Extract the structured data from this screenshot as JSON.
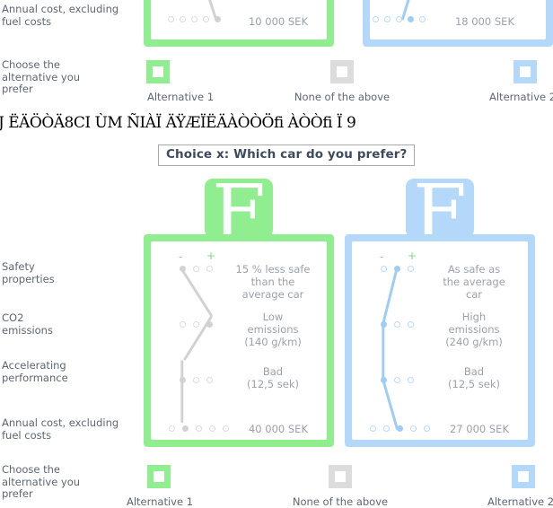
{
  "title": "Choice x: Which car do you prefer?",
  "garbled_line": "J ËÄÖÒÄ8CI ÙM  ÑIÀÏ ÄŸÆÏËÄÀÒÒÖfi   ÀÒÒfi Ï 9",
  "attribute_labels": {
    "safety": "Safety\nproperties",
    "co2": "CO2\nemissions",
    "accel": "Accelerating\nperformance",
    "cost": "Annual cost, excluding\nfuel costs",
    "choose": "Choose the\nalternative you\nprefer"
  },
  "colors": {
    "green": "#90ee90",
    "blue": "#b4d8fa",
    "gray": "#dcdcdc",
    "text": "#5d6773",
    "value_text": "#9aa2ac",
    "title_text": "#3e4a5e"
  },
  "scale_markers": {
    "minus": "-",
    "plus": "+"
  },
  "card_glyph": "F",
  "top_block": {
    "alt1": {
      "cost_value": "10 000 SEK",
      "cost_dots": 5,
      "cost_selected": 5,
      "color": "green"
    },
    "alt2": {
      "cost_value": "18 000 SEK",
      "cost_dots": 5,
      "cost_selected": 4,
      "color": "blue"
    },
    "choices": [
      {
        "label": "Alternative 1",
        "color": "green"
      },
      {
        "label": "None of the above",
        "color": "gray"
      },
      {
        "label": "Alternative 2",
        "color": "blue"
      }
    ]
  },
  "main_block": {
    "alt1": {
      "color": "green",
      "rows": [
        {
          "attr": "safety",
          "dots": 3,
          "selected": 1,
          "text": "15 % less safe\nthan the\naverage car"
        },
        {
          "attr": "co2",
          "dots": 3,
          "selected": 3,
          "text": "Low\nemissions\n(140 g/km)"
        },
        {
          "attr": "accel",
          "dots": 3,
          "selected": 1,
          "text": "Bad\n(12,5 sek)"
        },
        {
          "attr": "cost",
          "dots": 5,
          "selected": 2,
          "text": "40 000 SEK"
        }
      ]
    },
    "alt2": {
      "color": "blue",
      "rows": [
        {
          "attr": "safety",
          "dots": 3,
          "selected": 2,
          "text": "As safe as\nthe average\ncar"
        },
        {
          "attr": "co2",
          "dots": 3,
          "selected": 1,
          "text": "High\nemissions\n(240 g/km)"
        },
        {
          "attr": "accel",
          "dots": 3,
          "selected": 1,
          "text": "Bad\n(12,5 sek)"
        },
        {
          "attr": "cost",
          "dots": 5,
          "selected": 3,
          "text": "27 000 SEK"
        }
      ]
    },
    "choices": [
      {
        "label": "Alternative 1",
        "color": "green"
      },
      {
        "label": "None of the above",
        "color": "gray"
      },
      {
        "label": "Alternative 2",
        "color": "blue"
      }
    ]
  }
}
